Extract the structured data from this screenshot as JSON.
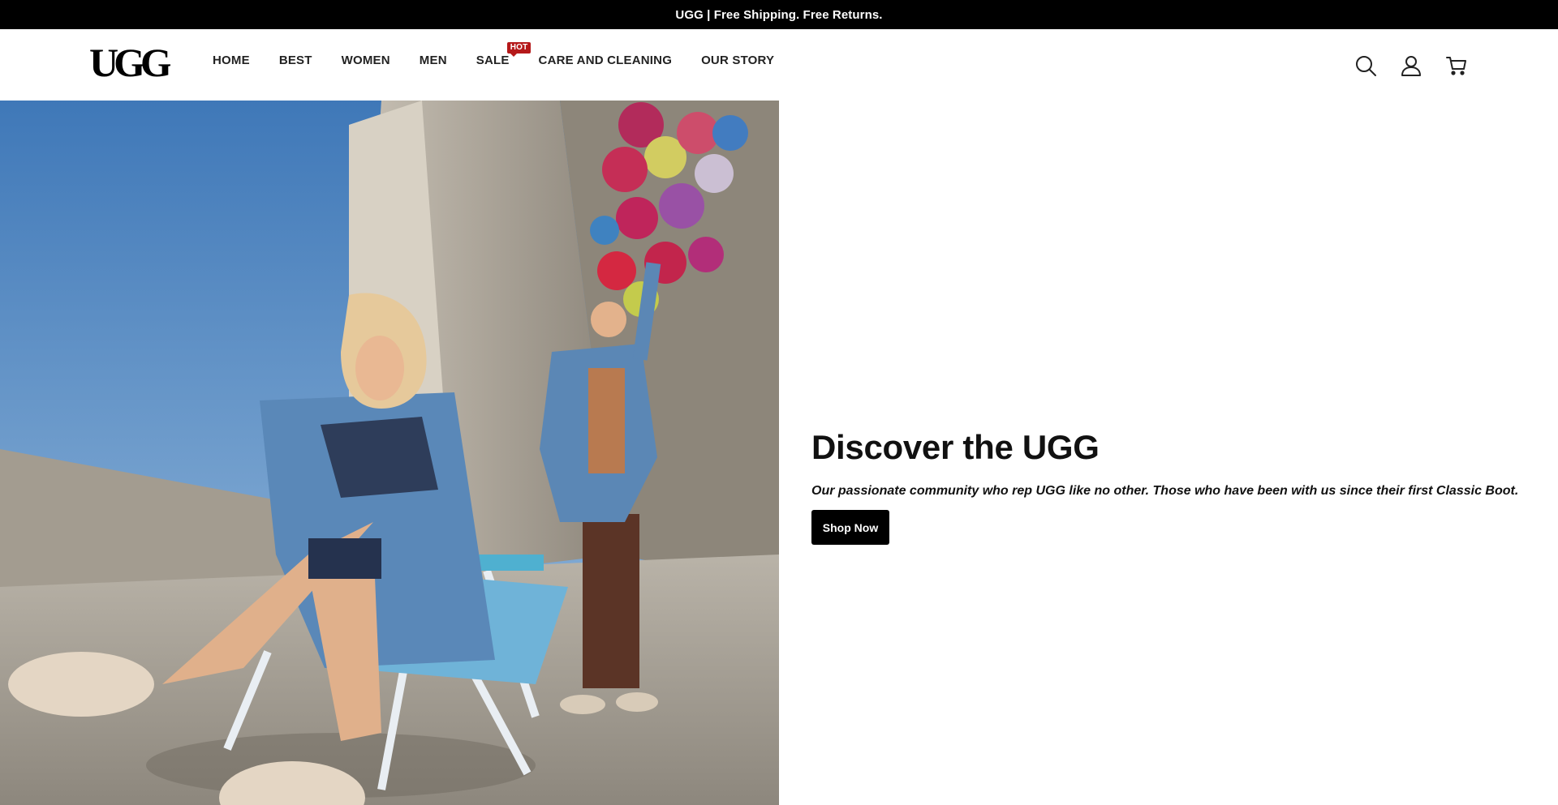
{
  "announcement": "UGG | Free Shipping. Free Returns.",
  "logo_text": "UGG",
  "nav": {
    "items": [
      {
        "label": "HOME"
      },
      {
        "label": "BEST"
      },
      {
        "label": "WOMEN"
      },
      {
        "label": "MEN"
      },
      {
        "label": "SALE",
        "badge": "HOT"
      },
      {
        "label": "CARE AND CLEANING"
      },
      {
        "label": "OUR STORY"
      }
    ]
  },
  "header_icons": [
    "search-icon",
    "account-icon",
    "cart-icon"
  ],
  "hero": {
    "title": "Discover the UGG",
    "subtitle": "Our passionate community who rep UGG like no other. Those who have been with us since their first Classic Boot.",
    "cta_label": "Shop Now"
  },
  "colors": {
    "announcement_bg": "#000000",
    "badge": "#b5191a",
    "cta_bg": "#000000"
  }
}
